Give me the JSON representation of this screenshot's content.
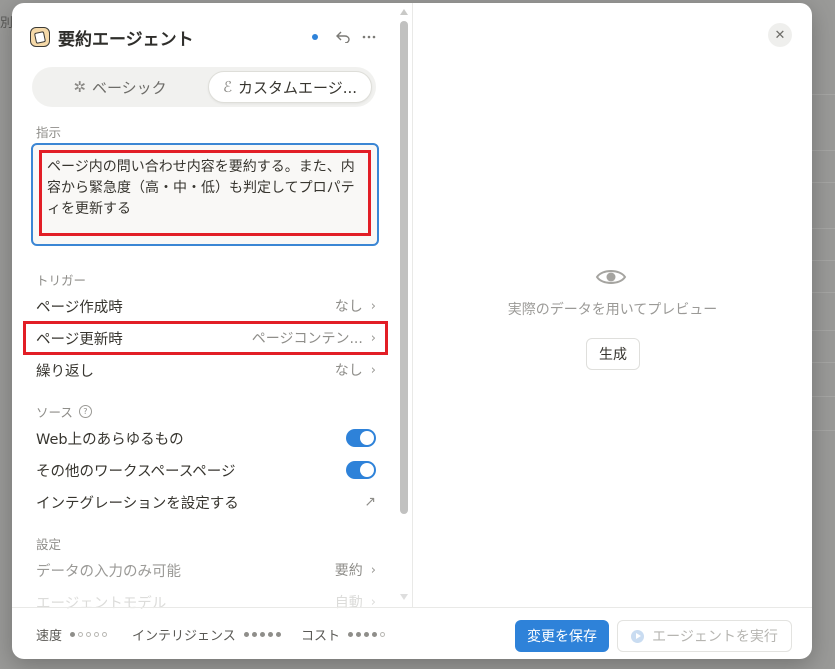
{
  "background": {
    "fragment": "別"
  },
  "header": {
    "title": "要約エージェント",
    "undo_icon": "undo-icon",
    "more_icon": "more-icon"
  },
  "mode_tabs": [
    {
      "label": "ベーシック",
      "icon": "sparkle-icon",
      "selected": false
    },
    {
      "label": "カスタムエージ...",
      "icon": "custom-agent-icon",
      "selected": true
    }
  ],
  "instructions": {
    "label": "指示",
    "text": "ページ内の問い合わせ内容を要約する。また、内容から緊急度（高・中・低）も判定してプロパティを更新する"
  },
  "triggers": {
    "label": "トリガー",
    "items": [
      {
        "label": "ページ作成時",
        "value": "なし"
      },
      {
        "label": "ページ更新時",
        "value": "ページコンテン..."
      },
      {
        "label": "繰り返し",
        "value": "なし"
      }
    ]
  },
  "sources": {
    "label": "ソース",
    "items": [
      {
        "label": "Web上のあらゆるもの",
        "enabled": true
      },
      {
        "label": "その他のワークスペースページ",
        "enabled": true
      }
    ],
    "integration_label": "インテグレーションを設定する"
  },
  "settings": {
    "label": "設定",
    "items": [
      {
        "label": "データの入力のみ可能",
        "value": "要約"
      },
      {
        "label": "エージェントモデル",
        "value": "自動"
      }
    ]
  },
  "preview": {
    "text": "実際のデータを用いてプレビュー",
    "generate_label": "生成"
  },
  "footer": {
    "metrics": [
      {
        "label": "速度",
        "level": 1,
        "max": 5
      },
      {
        "label": "インテリジェンス",
        "level": 5,
        "max": 5
      },
      {
        "label": "コスト",
        "level": 4,
        "max": 5
      }
    ],
    "save_label": "変更を保存",
    "run_label": "エージェントを実行"
  },
  "colors": {
    "accent": "#2e82d9",
    "highlight": "#e21e26"
  }
}
